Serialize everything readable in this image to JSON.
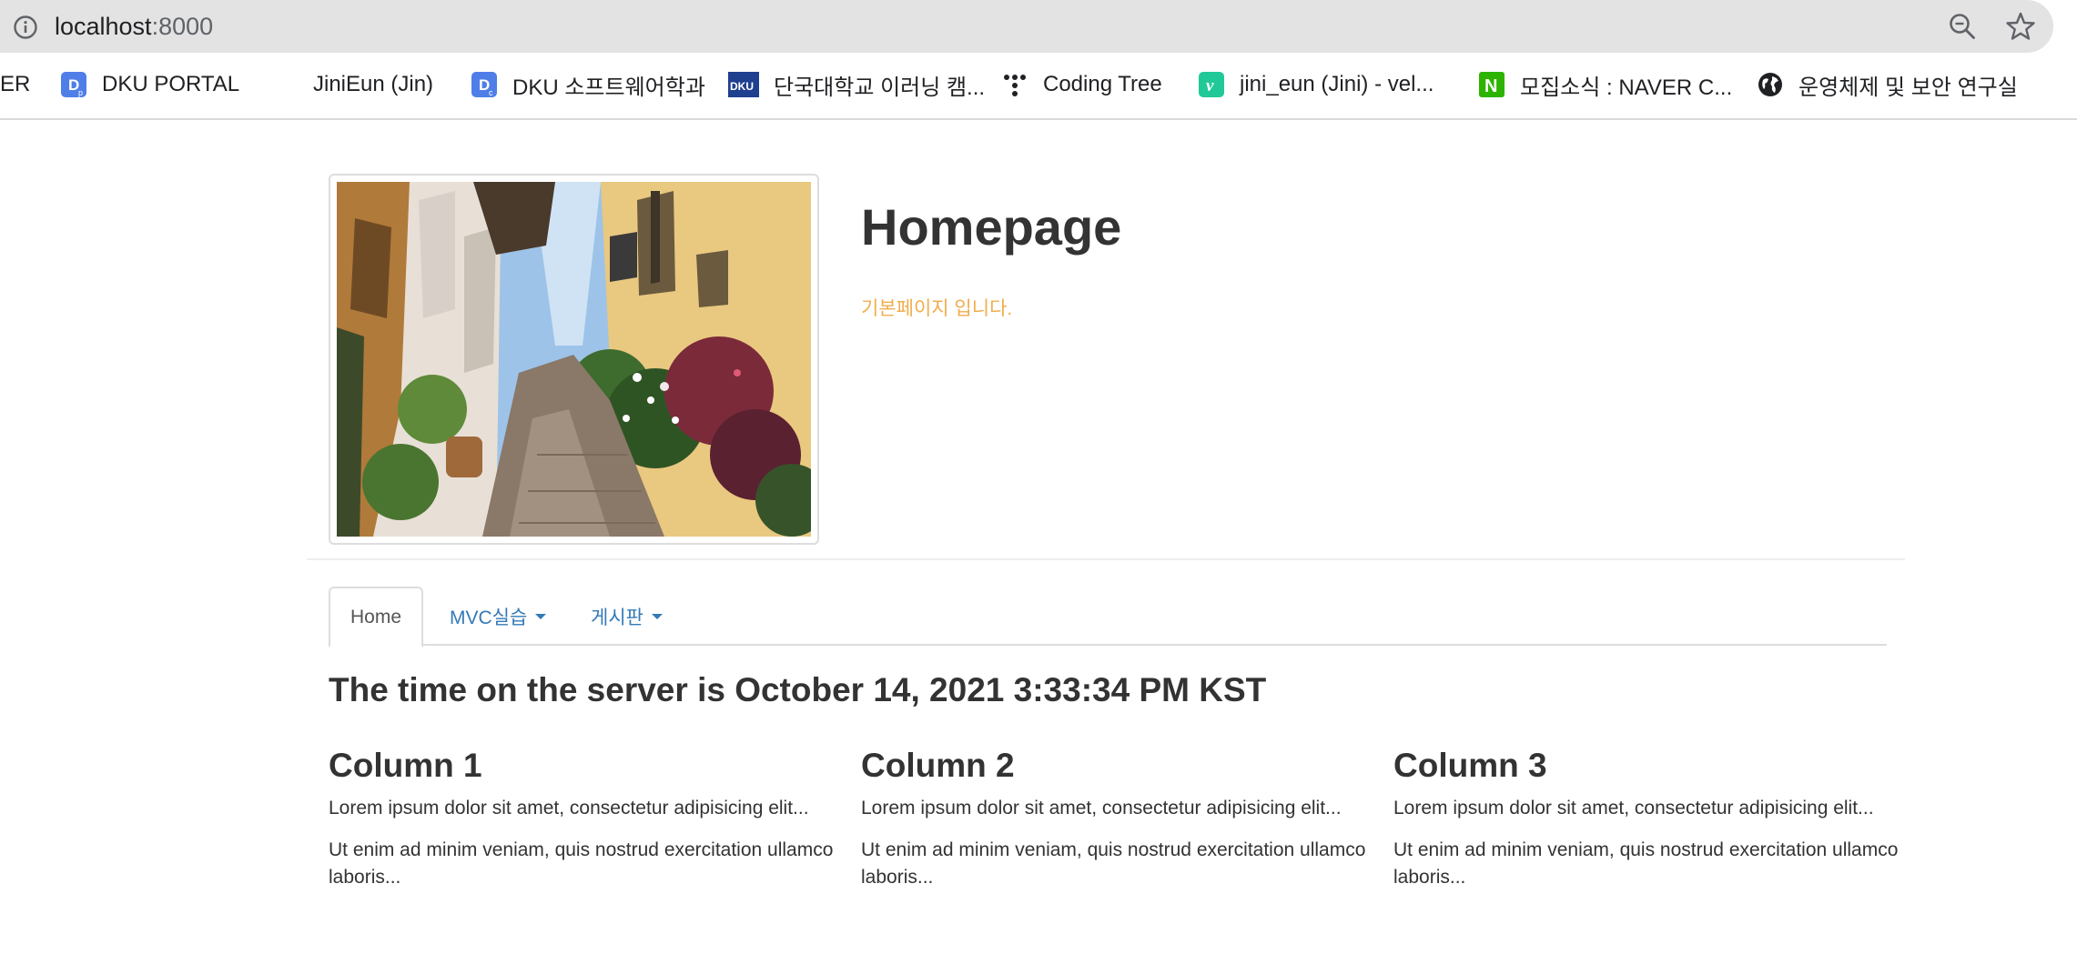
{
  "browser": {
    "url_host": "localhost",
    "url_port": ":8000",
    "bookmarks": [
      {
        "label": "ER",
        "icon": "none"
      },
      {
        "label": "DKU PORTAL",
        "icon": "dku-portal-icon"
      },
      {
        "label": "JiniEun (Jin)",
        "icon": "none"
      },
      {
        "label": "DKU 소프트웨어학과",
        "icon": "dku-software-icon"
      },
      {
        "label": "단국대학교 이러닝 캠...",
        "icon": "dku-elearning-icon"
      },
      {
        "label": "Coding Tree",
        "icon": "coding-tree-icon"
      },
      {
        "label": "jini_eun (Jini) - vel...",
        "icon": "velog-icon"
      },
      {
        "label": "모집소식 : NAVER C...",
        "icon": "naver-icon"
      },
      {
        "label": "운영체제 및 보안 연구실",
        "icon": "globe-icon"
      }
    ]
  },
  "header": {
    "title": "Homepage",
    "subtitle": "기본페이지 입니다."
  },
  "nav": {
    "tabs": [
      {
        "label": "Home",
        "active": true
      },
      {
        "label": "MVC실습",
        "dropdown": true
      },
      {
        "label": "게시판",
        "dropdown": true
      }
    ]
  },
  "main": {
    "server_time": "The time on the server is October 14, 2021 3:33:34 PM KST",
    "columns": [
      {
        "title": "Column 1",
        "p1": "Lorem ipsum dolor sit amet, consectetur adipisicing elit...",
        "p2": "Ut enim ad minim veniam, quis nostrud exercitation ullamco laboris..."
      },
      {
        "title": "Column 2",
        "p1": "Lorem ipsum dolor sit amet, consectetur adipisicing elit...",
        "p2": "Ut enim ad minim veniam, quis nostrud exercitation ullamco laboris..."
      },
      {
        "title": "Column 3",
        "p1": "Lorem ipsum dolor sit amet, consectetur adipisicing elit...",
        "p2": "Ut enim ad minim veniam, quis nostrud exercitation ullamco laboris..."
      }
    ]
  },
  "colors": {
    "link": "#337ab7",
    "subtitle": "#f0ad4e",
    "text": "#333333"
  }
}
